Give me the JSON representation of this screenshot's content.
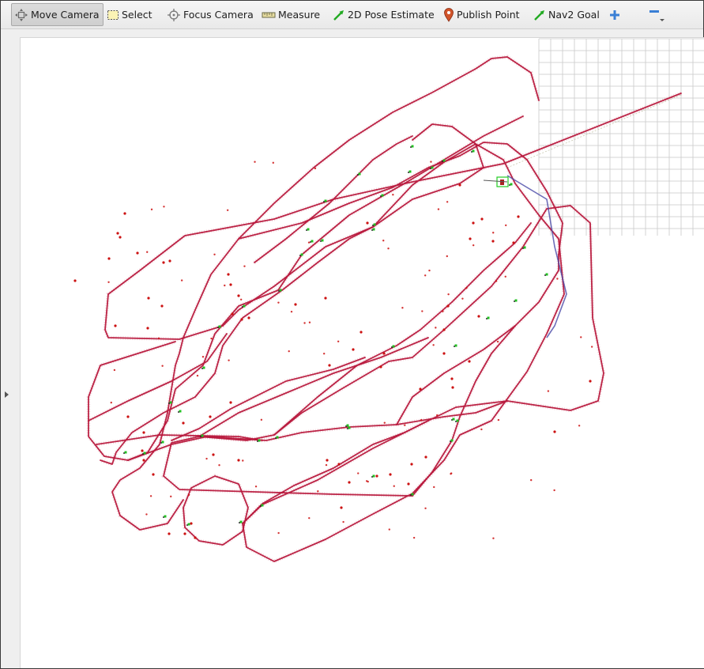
{
  "toolbar": {
    "tools": [
      {
        "id": "move-camera",
        "label": "Move Camera",
        "icon": "move-camera-icon",
        "active": true
      },
      {
        "id": "select",
        "label": "Select",
        "icon": "select-icon",
        "active": false
      },
      {
        "id": "focus-camera",
        "label": "Focus Camera",
        "icon": "focus-camera-icon",
        "active": false
      },
      {
        "id": "measure",
        "label": "Measure",
        "icon": "measure-icon",
        "active": false
      },
      {
        "id": "pose-estimate",
        "label": "2D Pose Estimate",
        "icon": "pose-arrow-icon",
        "active": false
      },
      {
        "id": "publish-point",
        "label": "Publish Point",
        "icon": "map-pin-icon",
        "active": false
      },
      {
        "id": "nav2-goal",
        "label": "Nav2 Goal",
        "icon": "goal-arrow-icon",
        "active": false
      }
    ],
    "add_tool_icon": "plus-icon",
    "remove_tool_icon": "minus-icon"
  },
  "colors": {
    "trajectory": "#b8183c",
    "landmark": "#cc1111",
    "keyframe": "#20c020",
    "grid": "#c8c8c8",
    "accent_blue": "#3a7fd5",
    "pose_green": "#22cc22",
    "pin": "#d0542a"
  },
  "viewport": {
    "description_icon": "3d-render-view"
  }
}
